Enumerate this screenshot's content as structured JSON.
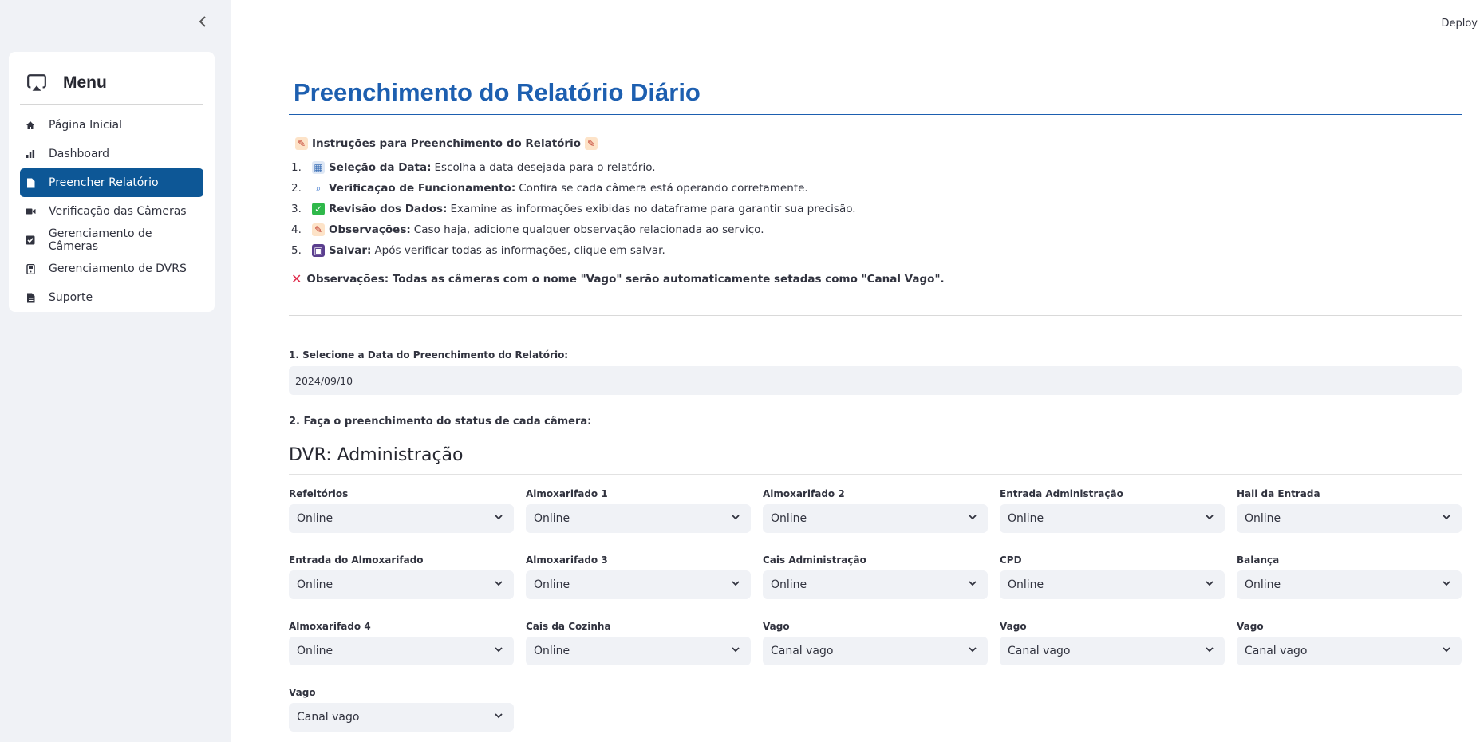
{
  "sidebar": {
    "menu_title": "Menu",
    "items": [
      {
        "label": "Página Inicial",
        "icon": "home-icon",
        "active": false
      },
      {
        "label": "Dashboard",
        "icon": "bar-chart-icon",
        "active": false
      },
      {
        "label": "Preencher Relatório",
        "icon": "document-icon",
        "active": true
      },
      {
        "label": "Verificação das Câmeras",
        "icon": "video-camera-icon",
        "active": false
      },
      {
        "label": "Gerenciamento de Câmeras",
        "icon": "checkbox-icon",
        "active": false
      },
      {
        "label": "Gerenciamento de DVRS",
        "icon": "storage-icon",
        "active": false
      },
      {
        "label": "Suporte",
        "icon": "document-icon",
        "active": false
      }
    ]
  },
  "header": {
    "deploy_label": "Deploy"
  },
  "main": {
    "title": "Preenchimento do Relatório Diário",
    "instructions_title": "Instruções para Preenchimento do Relatório",
    "steps": [
      {
        "num": "1.",
        "bold": "Seleção da Data:",
        "text": "Escolha a data desejada para o relatório.",
        "icon": "calendar-icon"
      },
      {
        "num": "2.",
        "bold": "Verificação de Funcionamento:",
        "text": "Confira se cada câmera está operando corretamente.",
        "icon": "magnifier-icon"
      },
      {
        "num": "3.",
        "bold": "Revisão dos Dados:",
        "text": "Examine as informações exibidas no dataframe para garantir sua precisão.",
        "icon": "check-mark-icon"
      },
      {
        "num": "4.",
        "bold": "Observações:",
        "text": "Caso haja, adicione qualquer observação relacionada ao serviço.",
        "icon": "memo-icon"
      },
      {
        "num": "5.",
        "bold": "Salvar:",
        "text": "Após verificar todas as informações, clique em salvar.",
        "icon": "floppy-disk-icon"
      }
    ],
    "note": "Observações: Todas as câmeras com o nome \"Vago\" serão automaticamente setadas como \"Canal Vago\".",
    "date_label": "1. Selecione a Data do Preenchimento do Relatório:",
    "date_value": "2024/09/10",
    "status_label": "2. Faça o preenchimento do status de cada câmera:",
    "dvr_title": "DVR: Administração",
    "cameras": [
      {
        "label": "Refeitórios",
        "value": "Online"
      },
      {
        "label": "Almoxarifado 1",
        "value": "Online"
      },
      {
        "label": "Almoxarifado 2",
        "value": "Online"
      },
      {
        "label": "Entrada Administração",
        "value": "Online"
      },
      {
        "label": "Hall da Entrada",
        "value": "Online"
      },
      {
        "label": "Entrada do Almoxarifado",
        "value": "Online"
      },
      {
        "label": "Almoxarifado 3",
        "value": "Online"
      },
      {
        "label": "Cais Administração",
        "value": "Online"
      },
      {
        "label": "CPD",
        "value": "Online"
      },
      {
        "label": "Balança",
        "value": "Online"
      },
      {
        "label": "Almoxarifado 4",
        "value": "Online"
      },
      {
        "label": "Cais da Cozinha",
        "value": "Online"
      },
      {
        "label": "Vago",
        "value": "Canal vago"
      },
      {
        "label": "Vago",
        "value": "Canal vago"
      },
      {
        "label": "Vago",
        "value": "Canal vago"
      },
      {
        "label": "Vago",
        "value": "Canal vago"
      }
    ]
  },
  "colors": {
    "accent": "#0d5796",
    "title": "#1d5fb0",
    "sidebar_bg": "#f0f2f6",
    "error": "#e0294a"
  }
}
